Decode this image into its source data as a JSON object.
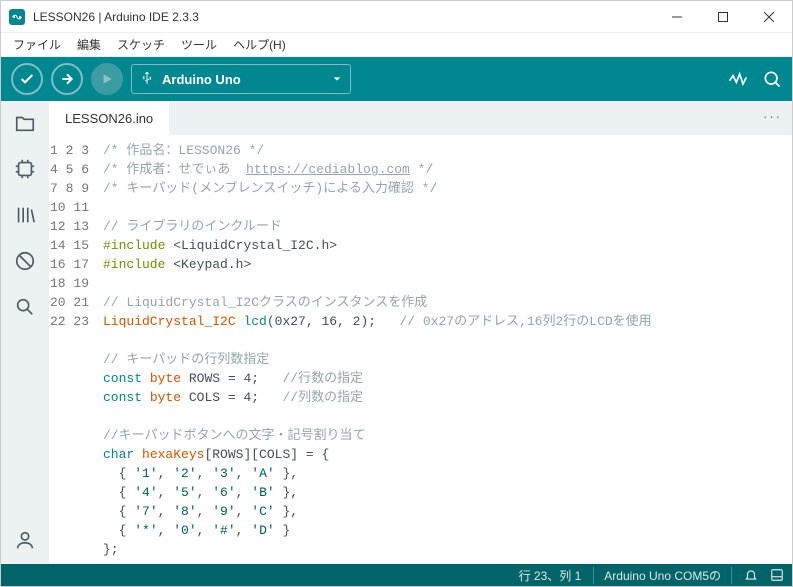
{
  "window": {
    "title": "LESSON26 | Arduino IDE 2.3.3"
  },
  "menu": {
    "file": "ファイル",
    "edit": "編集",
    "sketch": "スケッチ",
    "tools": "ツール",
    "help": "ヘルプ(H)"
  },
  "board": {
    "name": "Arduino Uno"
  },
  "tab": {
    "name": "LESSON26.ino"
  },
  "code": {
    "lines": [
      {
        "n": "1",
        "t": "comment",
        "text": "/* 作品名：LESSON26 */"
      },
      {
        "n": "2",
        "t": "comment_link",
        "prefix": "/* 作成者：せでぃあ  ",
        "link": "https://cediablog.com",
        "suffix": " */"
      },
      {
        "n": "3",
        "t": "comment",
        "text": "/* キーパッド(メンブレンスイッチ)による入力確認 */"
      },
      {
        "n": "4",
        "t": "blank",
        "text": ""
      },
      {
        "n": "5",
        "t": "comment",
        "text": "// ライブラリのインクルード"
      },
      {
        "n": "6",
        "t": "include",
        "directive": "#include",
        "target": "<LiquidCrystal_I2C.h>"
      },
      {
        "n": "7",
        "t": "include",
        "directive": "#include",
        "target": "<Keypad.h>"
      },
      {
        "n": "8",
        "t": "blank",
        "text": ""
      },
      {
        "n": "9",
        "t": "comment",
        "text": "// LiquidCrystal_I2Cクラスのインスタンスを作成"
      },
      {
        "n": "10",
        "t": "lcd",
        "cls": "LiquidCrystal_I2C",
        "obj": "lcd",
        "args": "(0x27, 16, 2);",
        "tail": "   // 0x27のアドレス,16列2行のLCDを使用"
      },
      {
        "n": "11",
        "t": "blank",
        "text": ""
      },
      {
        "n": "12",
        "t": "comment",
        "text": "// キーパッドの行列数指定"
      },
      {
        "n": "13",
        "t": "decl",
        "kw": "const",
        "type": "byte",
        "rest": " ROWS = 4;   ",
        "cmt": "//行数の指定"
      },
      {
        "n": "14",
        "t": "decl",
        "kw": "const",
        "type": "byte",
        "rest": " COLS = 4;   ",
        "cmt": "//列数の指定"
      },
      {
        "n": "15",
        "t": "blank",
        "text": ""
      },
      {
        "n": "16",
        "t": "comment",
        "text": "//キーパッドボタンへの文字・記号割り当て"
      },
      {
        "n": "17",
        "t": "chararr",
        "kw": "char",
        "name": "hexaKeys",
        "rest": "[ROWS][COLS] = {"
      },
      {
        "n": "18",
        "t": "row",
        "text": "  { '1', '2', '3', 'A' },"
      },
      {
        "n": "19",
        "t": "row",
        "text": "  { '4', '5', '6', 'B' },"
      },
      {
        "n": "20",
        "t": "row",
        "text": "  { '7', '8', '9', 'C' },"
      },
      {
        "n": "21",
        "t": "row",
        "text": "  { '*', '0', '#', 'D' }"
      },
      {
        "n": "22",
        "t": "plain",
        "text": "};"
      },
      {
        "n": "23",
        "t": "blank",
        "text": ""
      }
    ]
  },
  "status": {
    "cursor": "行 23、列 1",
    "port": "Arduino Uno COM5の"
  }
}
